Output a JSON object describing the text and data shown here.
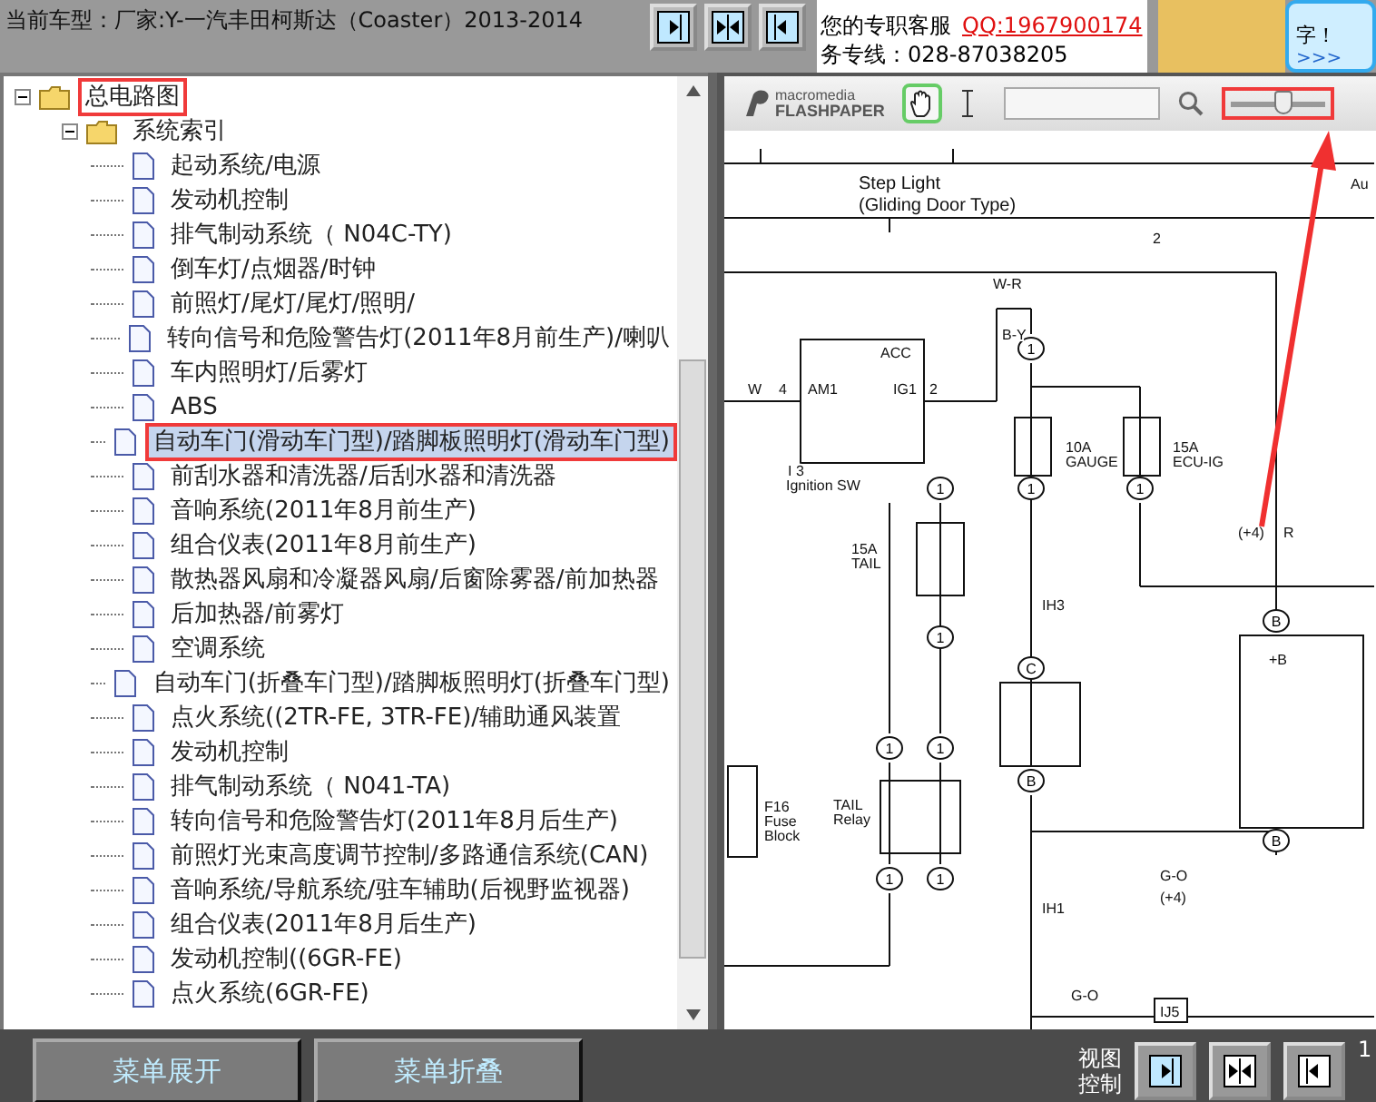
{
  "header": {
    "title": "当前车型：厂家:Y-一汽丰田柯斯达（Coaster）2013-2014"
  },
  "ad": {
    "service_label": "您的专职客服",
    "qq": "QQ:1967900174",
    "hotline": "务专线：028-87038205",
    "bubble_text": "字！",
    "bubble_link": ">>>"
  },
  "tree": {
    "label": "总电路图",
    "expanded": true,
    "marked": true,
    "children": [
      {
        "label": "系统索引",
        "expanded": true,
        "children": [
          {
            "label": "起动系统/电源",
            "selected": false,
            "marked": false
          },
          {
            "label": "发动机控制",
            "selected": false,
            "marked": false
          },
          {
            "label": "排气制动系统（ N04C-TY)",
            "selected": false,
            "marked": false
          },
          {
            "label": "倒车灯/点烟器/时钟",
            "selected": false,
            "marked": false
          },
          {
            "label": "前照灯/尾灯/尾灯/照明/",
            "selected": false,
            "marked": false
          },
          {
            "label": "转向信号和危险警告灯(2011年8月前生产)/喇叭",
            "selected": false,
            "marked": false
          },
          {
            "label": "车内照明灯/后雾灯",
            "selected": false,
            "marked": false
          },
          {
            "label": "ABS",
            "selected": false,
            "marked": false
          },
          {
            "label": "自动车门(滑动车门型)/踏脚板照明灯(滑动车门型)",
            "selected": true,
            "marked": true
          },
          {
            "label": "前刮水器和清洗器/后刮水器和清洗器",
            "selected": false,
            "marked": false
          },
          {
            "label": "音响系统(2011年8月前生产)",
            "selected": false,
            "marked": false
          },
          {
            "label": "组合仪表(2011年8月前生产)",
            "selected": false,
            "marked": false
          },
          {
            "label": "散热器风扇和冷凝器风扇/后窗除雾器/前加热器",
            "selected": false,
            "marked": false
          },
          {
            "label": "后加热器/前雾灯",
            "selected": false,
            "marked": false
          },
          {
            "label": "空调系统",
            "selected": false,
            "marked": false
          },
          {
            "label": "自动车门(折叠车门型)/踏脚板照明灯(折叠车门型)",
            "selected": false,
            "marked": false
          },
          {
            "label": "点火系统((2TR-FE, 3TR-FE)/辅助通风装置",
            "selected": false,
            "marked": false
          },
          {
            "label": "发动机控制",
            "selected": false,
            "marked": false
          },
          {
            "label": "排气制动系统（ N041-TA)",
            "selected": false,
            "marked": false
          },
          {
            "label": "转向信号和危险警告灯(2011年8月后生产)",
            "selected": false,
            "marked": false
          },
          {
            "label": "前照灯光束高度调节控制/多路通信系统(CAN)",
            "selected": false,
            "marked": false
          },
          {
            "label": "音响系统/导航系统/驻车辅助(后视野监视器)",
            "selected": false,
            "marked": false
          },
          {
            "label": "组合仪表(2011年8月后生产)",
            "selected": false,
            "marked": false
          },
          {
            "label": "发动机控制((6GR-FE)",
            "selected": false,
            "marked": false
          },
          {
            "label": "点火系统(6GR-FE)",
            "selected": false,
            "marked": false
          }
        ]
      }
    ]
  },
  "viewer": {
    "logo_top": "macromedia",
    "logo_bottom": "FLASHPAPER",
    "zoom": {
      "level": 0.55,
      "marked": true
    },
    "diagram": {
      "labels": [
        "Step Light",
        "(Gliding Door Type)",
        "Au",
        "2",
        "W-R",
        "ACC",
        "W",
        "4",
        "AM1",
        "IG1",
        "2",
        "I 3",
        "Ignition SW",
        "B-Y",
        "10A",
        "GAUGE",
        "15A",
        "ECU-IG",
        "15A",
        "TAIL",
        "IH3",
        "(+4)",
        "R",
        "+B",
        "F16",
        "Fuse",
        "Block",
        "TAIL",
        "Relay",
        "IH1",
        "G-O",
        "(+4)",
        "G-O",
        "IJ5"
      ],
      "connectors": [
        "1",
        "1",
        "1",
        "1",
        "1",
        "C",
        "B",
        "B",
        "B",
        "1",
        "1",
        "1",
        "1"
      ]
    }
  },
  "bottom": {
    "buttons": [
      "菜单展开",
      "菜单折叠"
    ],
    "view_label": [
      "视图",
      "控制"
    ],
    "page": "1"
  }
}
